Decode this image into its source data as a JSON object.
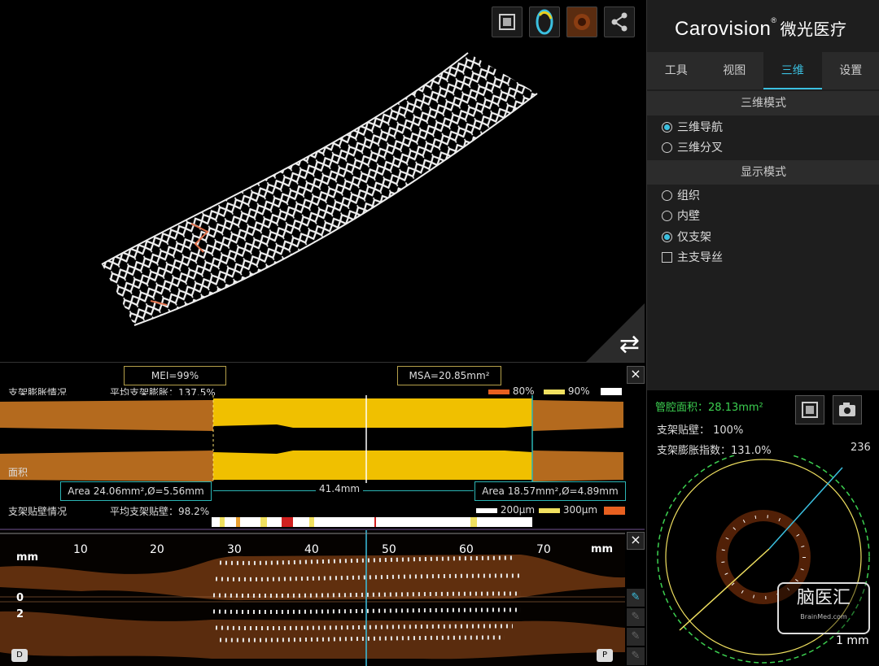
{
  "brand": {
    "name": "Carovision",
    "reg": "®",
    "chinese": "微光医疗"
  },
  "tabs": [
    {
      "label": "工具"
    },
    {
      "label": "视图"
    },
    {
      "label": "三维",
      "active": true
    },
    {
      "label": "设置"
    }
  ],
  "mode3d": {
    "title": "三维模式",
    "options": [
      {
        "label": "三维导航",
        "selected": true
      },
      {
        "label": "三维分叉",
        "selected": false
      }
    ]
  },
  "display": {
    "title": "显示模式",
    "options": [
      {
        "label": "组织",
        "selected": false
      },
      {
        "label": "内壁",
        "selected": false
      },
      {
        "label": "仅支架",
        "selected": true
      }
    ],
    "checkbox": {
      "label": "主支导丝",
      "checked": false
    }
  },
  "toolbar3d": {
    "icons": [
      "fullscreen-icon",
      "ring-view-icon",
      "tissue-view-icon",
      "share-icon"
    ]
  },
  "expansion": {
    "title": "支架膨胀情况",
    "avg": "平均支架膨胀：137.5%",
    "mei": "MEI=99%",
    "msa": "MSA=20.85mm²",
    "legend80": "80%",
    "legend90": "90%",
    "area_label": "面积",
    "left_area": "Area 24.06mm²,Ø=5.56mm",
    "length": "41.4mm",
    "right_area": "Area 18.57mm²,Ø=4.89mm"
  },
  "apposition": {
    "title": "支架贴壁情况",
    "avg": "平均支架贴壁：98.2%",
    "legend200": "200μm",
    "legend300": "300μm"
  },
  "lview": {
    "mm_left": "mm",
    "mm_right": "mm",
    "ticks": [
      "10",
      "20",
      "30",
      "40",
      "50",
      "60",
      "70"
    ],
    "y_zero": "0",
    "y_two": "2",
    "distal": "D",
    "proximal": "P"
  },
  "cross": {
    "lumen_label": "管腔面积：",
    "lumen_value": "28.13mm²",
    "apposition": "支架贴壁：  100%",
    "expansion": "支架膨胀指数：131.0%",
    "frame": "236",
    "scale": "1 mm",
    "watermark": "脑医汇",
    "watermark_sub": "BrainMed.com"
  },
  "colors": {
    "accent": "#3bc0e0",
    "stent_yellow": "#f0c000",
    "vessel_orange": "#b46a1e",
    "green": "#3cd050",
    "teal": "#2bb5b5"
  }
}
